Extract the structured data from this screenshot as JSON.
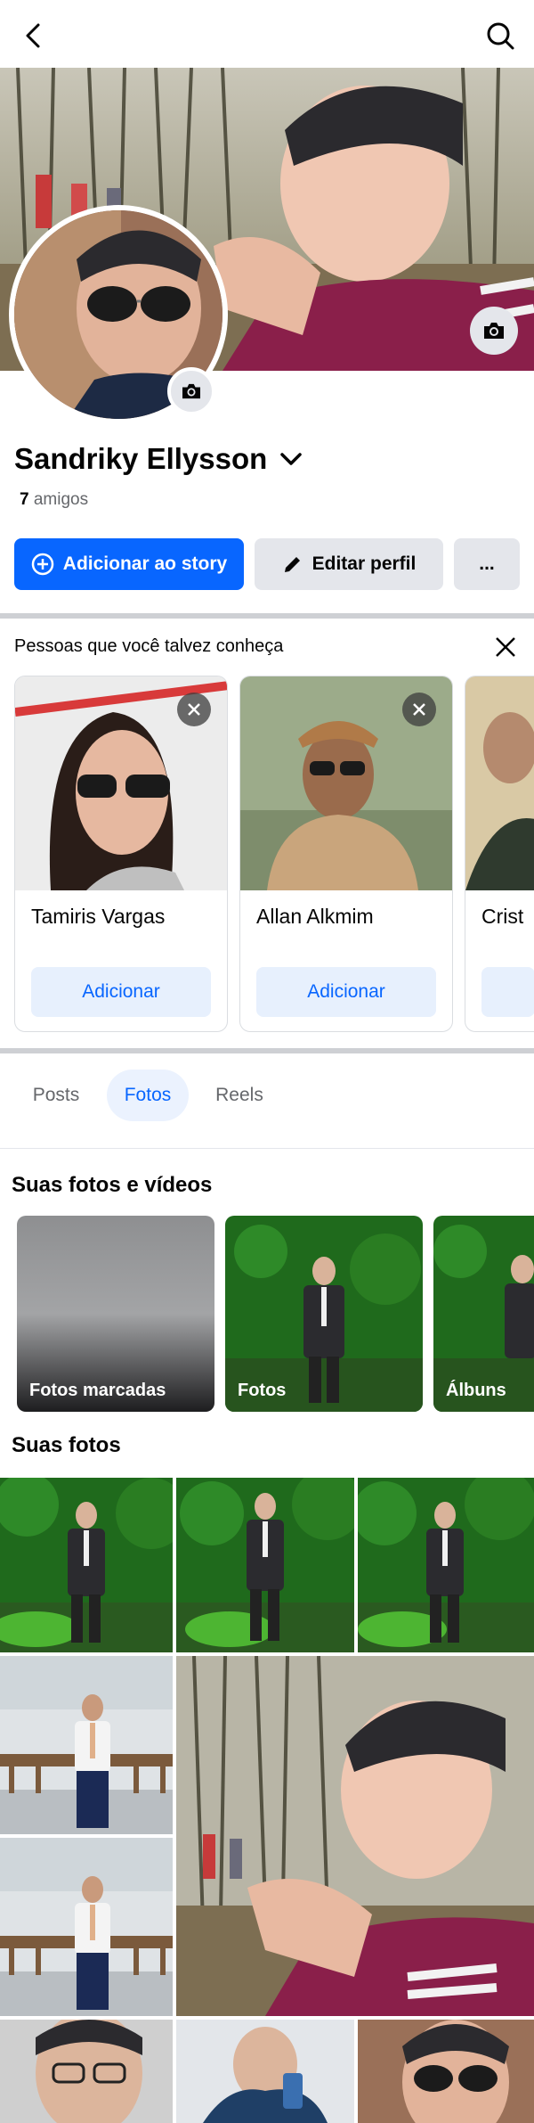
{
  "header": {
    "back_icon": "back-arrow-icon",
    "search_icon": "search-icon"
  },
  "profile": {
    "name": "Sandriky Ellysson",
    "friends_count": "7",
    "friends_label": "amigos"
  },
  "actions": {
    "story_label": "Adicionar ao story",
    "edit_label": "Editar perfil",
    "more_label": "..."
  },
  "pymk": {
    "title": "Pessoas que você talvez conheça",
    "cards": [
      {
        "name": "Tamiris Vargas",
        "button": "Adicionar"
      },
      {
        "name": "Allan Alkmim",
        "button": "Adicionar"
      },
      {
        "name": "Crist",
        "button": ""
      }
    ]
  },
  "tabs": [
    {
      "label": "Posts",
      "active": false
    },
    {
      "label": "Fotos",
      "active": true
    },
    {
      "label": "Reels",
      "active": false
    }
  ],
  "photos_section": {
    "title": "Suas fotos e vídeos",
    "tiles": [
      {
        "label": "Fotos marcadas"
      },
      {
        "label": "Fotos"
      },
      {
        "label": "Álbuns"
      }
    ]
  },
  "your_photos": {
    "title": "Suas fotos"
  },
  "colors": {
    "accent": "#0866ff",
    "button_gray": "#e4e6eb",
    "text_secondary": "#65676b"
  }
}
